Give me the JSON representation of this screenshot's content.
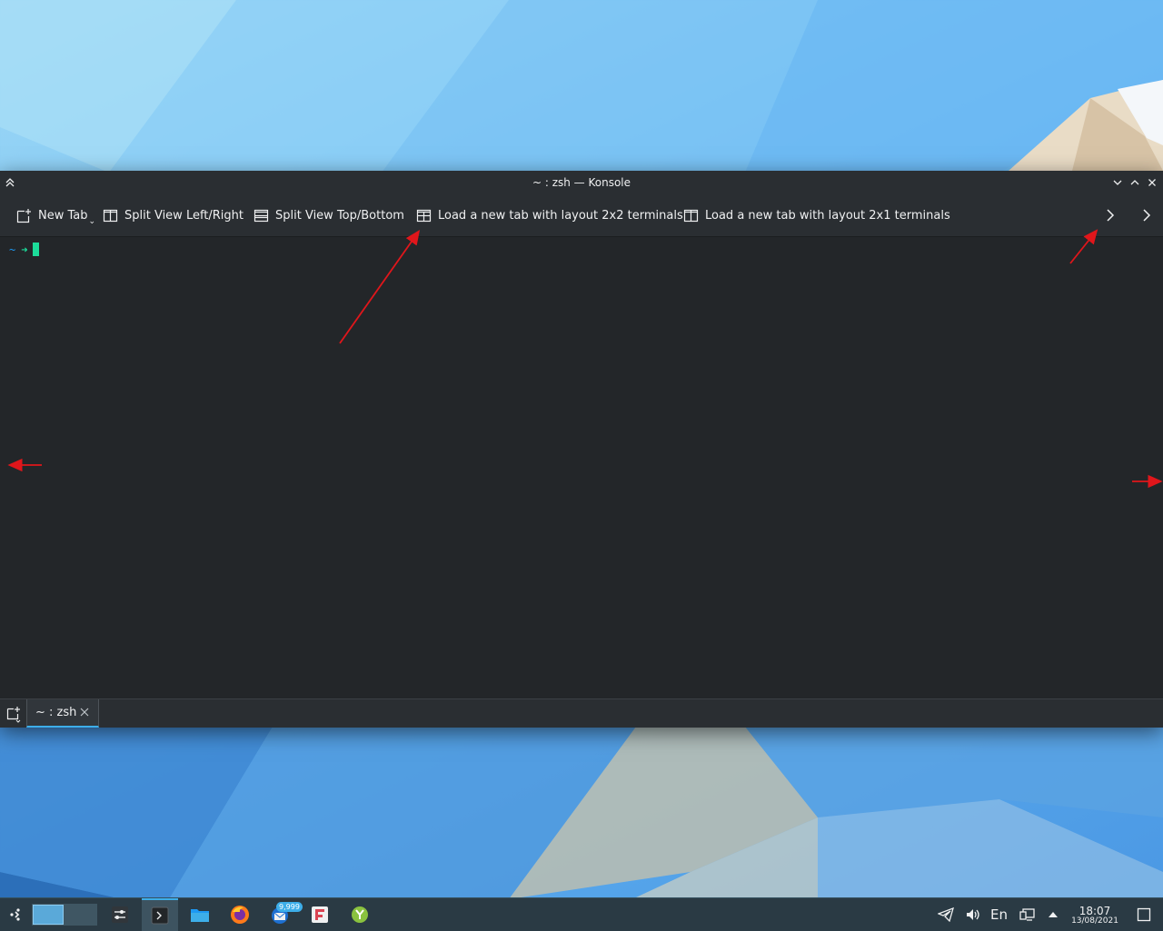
{
  "window": {
    "title": "~ : zsh — Konsole"
  },
  "toolbar": {
    "new_tab": "New Tab",
    "split_lr": "Split View Left/Right",
    "split_tb": "Split View Top/Bottom",
    "layout_2x2": "Load a new tab with layout 2x2 terminals",
    "layout_2x1": "Load a new tab with layout 2x1 terminals"
  },
  "terminal": {
    "prompt_dir": "~",
    "prompt_symbol": "➜"
  },
  "tabs": [
    {
      "label": "~ : zsh",
      "active": true
    }
  ],
  "taskbar": {
    "lang": "En",
    "time": "18:07",
    "date": "13/08/2021",
    "mail_badge": "9,999",
    "apps": [
      "application-launcher-icon",
      "virtual-desktop-pager",
      "system-settings-icon",
      "konsole-icon",
      "dolphin-icon",
      "firefox-icon",
      "thunderbird-icon",
      "flameshot-icon",
      "kde-connect-icon"
    ]
  },
  "colors": {
    "accent": "#3daee9",
    "prompt_green": "#1cdc9a",
    "prompt_blue": "#1d99f3",
    "annotation": "#e0161b"
  }
}
